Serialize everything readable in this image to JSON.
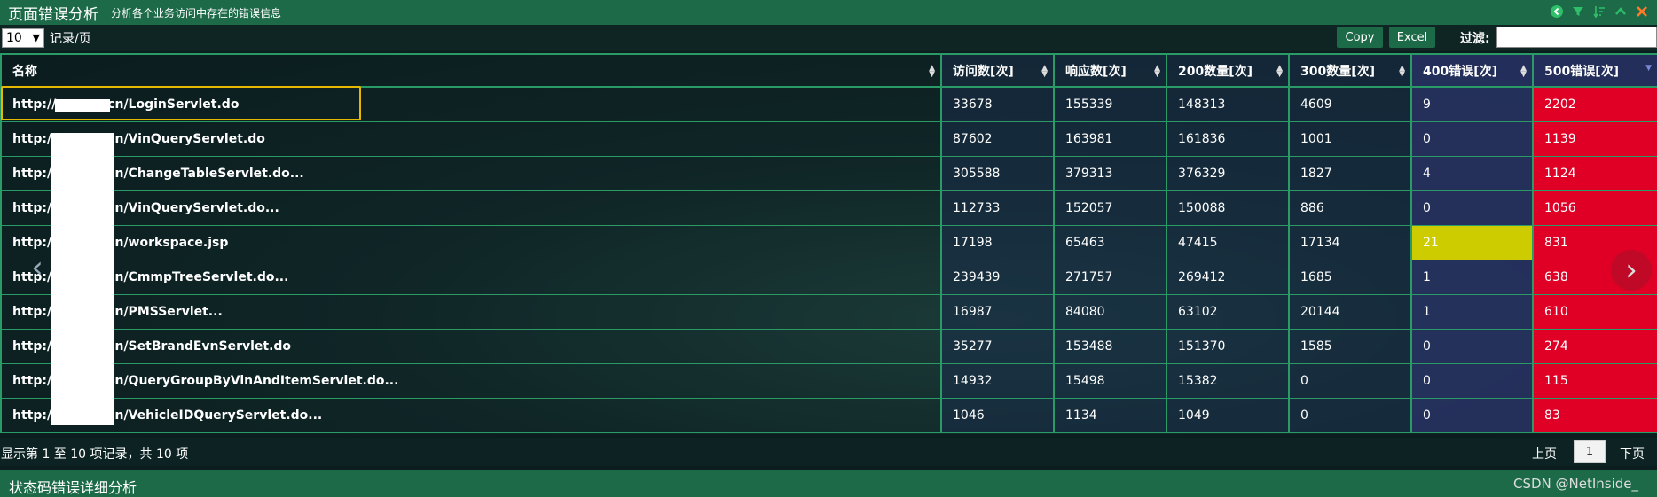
{
  "header": {
    "title": "页面错误分析",
    "subtitle": "分析各个业务访问中存在的错误信息"
  },
  "toolbar": {
    "page_size": "10",
    "records_per_page_label": "记录/页",
    "copy_label": "Copy",
    "excel_label": "Excel",
    "filter_label": "过滤:"
  },
  "table": {
    "columns": [
      "名称",
      "访问数[次]",
      "响应数[次]",
      "200数量[次]",
      "300数量[次]",
      "400错误[次]",
      "500错误[次]"
    ],
    "rows": [
      [
        "http://        n.com.cn/LoginServlet.do",
        "33678",
        "155339",
        "148313",
        "4609",
        "9",
        "2202"
      ],
      [
        "http://        n.com.cn/VinQueryServlet.do",
        "87602",
        "163981",
        "161836",
        "1001",
        "0",
        "1139"
      ],
      [
        "http://        n.com.cn/ChangeTableServlet.do...",
        "305588",
        "379313",
        "376329",
        "1827",
        "4",
        "1124"
      ],
      [
        "http://        n.com.cn/VinQueryServlet.do...",
        "112733",
        "152057",
        "150088",
        "886",
        "0",
        "1056"
      ],
      [
        "http://        n.com.cn/workspace.jsp",
        "17198",
        "65463",
        "47415",
        "17134",
        "21",
        "831"
      ],
      [
        "http://        n.com.cn/CmmpTreeServlet.do...",
        "239439",
        "271757",
        "269412",
        "1685",
        "1",
        "638"
      ],
      [
        "http://        n.com.cn/PMSServlet...",
        "16987",
        "84080",
        "63102",
        "20144",
        "1",
        "610"
      ],
      [
        "http://        n.com.cn/SetBrandEvnServlet.do",
        "35277",
        "153488",
        "151370",
        "1585",
        "0",
        "274"
      ],
      [
        "http://        n.com.cn/QueryGroupByVinAndItemServlet.do...",
        "14932",
        "15498",
        "15382",
        "0",
        "0",
        "115"
      ],
      [
        "http://        n.com.cn/VehicleIDQueryServlet.do...",
        "1046",
        "1134",
        "1049",
        "0",
        "0",
        "83"
      ]
    ],
    "warn_cell_color": "#cccc00",
    "error_cell_color": "#e00026"
  },
  "footer": {
    "info": "显示第 1 至 10 项记录，共 10 项",
    "prev_label": "上页",
    "current_page": "1",
    "next_label": "下页"
  },
  "bottom": {
    "title": "状态码错误详细分析",
    "watermark": "CSDN @NetInside_"
  },
  "icons": [
    "back-icon",
    "filter-icon",
    "sort-icon",
    "collapse-icon",
    "close-icon"
  ]
}
